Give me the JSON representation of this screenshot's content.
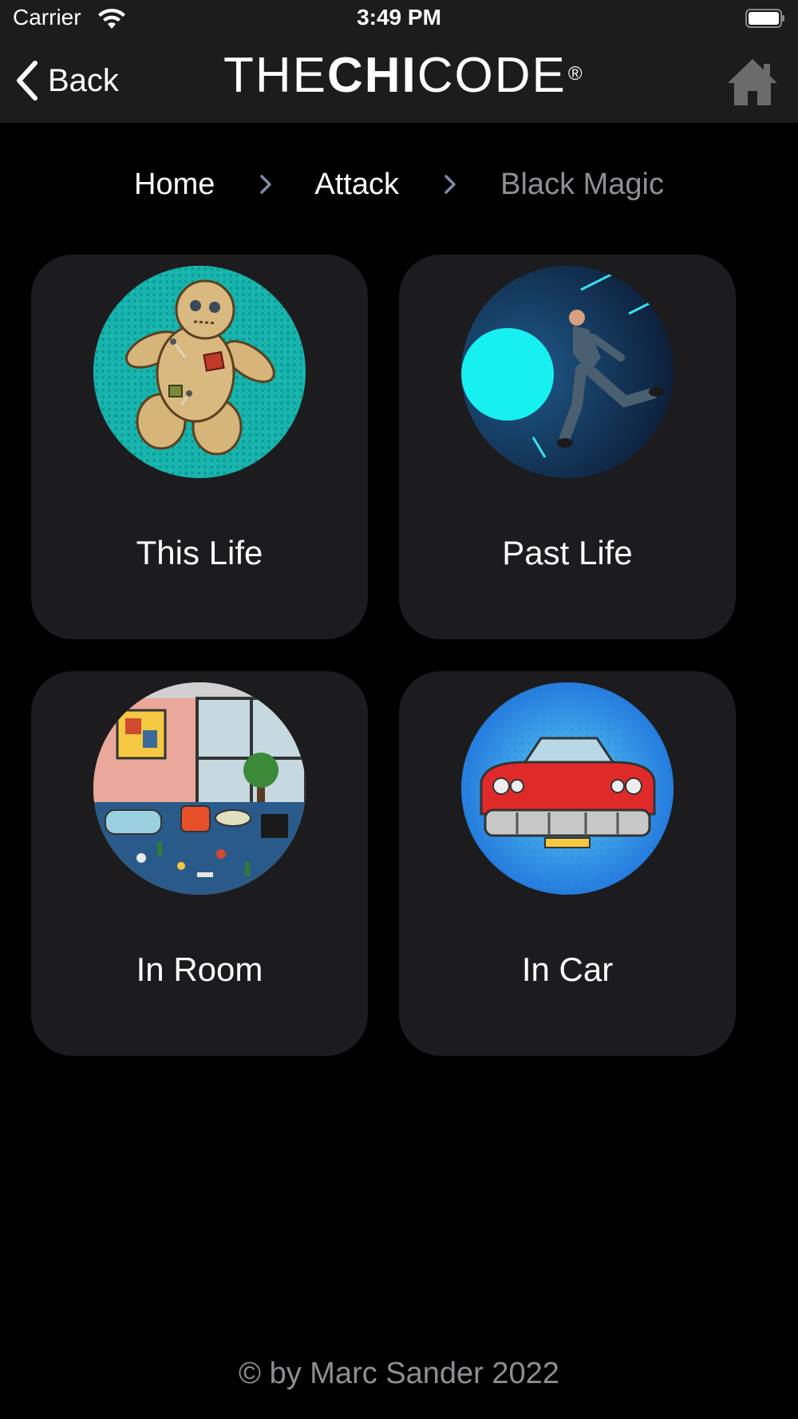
{
  "status_bar": {
    "carrier": "Carrier",
    "time": "3:49 PM"
  },
  "nav": {
    "back_label": "Back",
    "logo": {
      "part1": "THE",
      "part2": "CHI",
      "part3": "CODE",
      "mark": "®"
    }
  },
  "breadcrumb": {
    "items": [
      "Home",
      "Attack",
      "Black Magic"
    ]
  },
  "cards": [
    {
      "title": "This Life",
      "icon": "voodoo-doll-icon"
    },
    {
      "title": "Past Life",
      "icon": "running-man-portal-icon"
    },
    {
      "title": "In Room",
      "icon": "messy-room-icon"
    },
    {
      "title": "In Car",
      "icon": "red-car-icon"
    }
  ],
  "footer": {
    "text": "© by Marc Sander 2022"
  },
  "colors": {
    "background": "#000000",
    "bar": "#1c1c1c",
    "card": "#1c1c1e",
    "muted": "#8e8e93",
    "chevron": "#7f8aa8"
  }
}
